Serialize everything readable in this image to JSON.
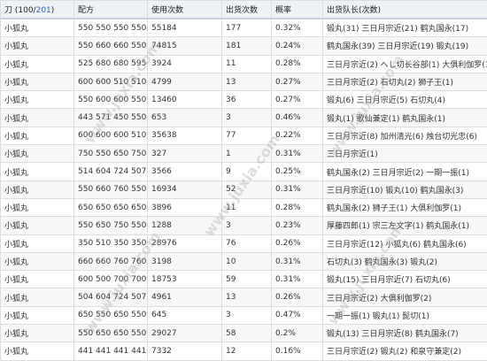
{
  "header": {
    "col1_prefix": "刀 (100/",
    "col1_count": "201",
    "col1_suffix": ")",
    "recipe": "配方",
    "uses": "使用次数",
    "drops": "出货次数",
    "rate": "概率",
    "captain": "出货队长(次数)"
  },
  "rows": [
    {
      "name": "小狐丸",
      "recipe": "550 550 550 550",
      "uses": "55184",
      "drops": "177",
      "rate": "0.32%",
      "captain": "锻丸(31) 三日月宗近(21) 鹤丸国永(17)"
    },
    {
      "name": "小狐丸",
      "recipe": "550 660 660 550",
      "uses": "74815",
      "drops": "181",
      "rate": "0.24%",
      "captain": "鹤丸国永(39) 三日月宗近(19) 锻丸(19)"
    },
    {
      "name": "小狐丸",
      "recipe": "525 680 680 595",
      "uses": "3924",
      "drops": "11",
      "rate": "0.28%",
      "captain": "三日月宗近(2) へし切长谷部(1) 大俱利伽罗(1)"
    },
    {
      "name": "小狐丸",
      "recipe": "600 600 510 510",
      "uses": "4799",
      "drops": "13",
      "rate": "0.27%",
      "captain": "三日月宗近(2) 石切丸(2) 狮子王(1)"
    },
    {
      "name": "小狐丸",
      "recipe": "550 600 600 550",
      "uses": "13460",
      "drops": "36",
      "rate": "0.27%",
      "captain": "锻丸(6) 三日月宗近(5) 石切丸(4)"
    },
    {
      "name": "小狐丸",
      "recipe": "443 571 450 550",
      "uses": "653",
      "drops": "3",
      "rate": "0.46%",
      "captain": "锻丸(1) 歌仙兼定(1) 鹤丸国永(1)"
    },
    {
      "name": "小狐丸",
      "recipe": "600 600 600 510",
      "uses": "35638",
      "drops": "77",
      "rate": "0.22%",
      "captain": "三日月宗近(8) 加州清光(6) 烛台切光忠(6)"
    },
    {
      "name": "小狐丸",
      "recipe": "750 550 650 750",
      "uses": "327",
      "drops": "1",
      "rate": "0.31%",
      "captain": "三日月宗近(1)"
    },
    {
      "name": "小狐丸",
      "recipe": "514 604 724 507",
      "uses": "3566",
      "drops": "9",
      "rate": "0.25%",
      "captain": "鹤丸国永(2) 三日月宗近(2) 一期一振(1)"
    },
    {
      "name": "小狐丸",
      "recipe": "550 660 760 550",
      "uses": "16934",
      "drops": "52",
      "rate": "0.31%",
      "captain": "三日月宗近(10) 锻丸(10) 鹤丸国永(3)"
    },
    {
      "name": "小狐丸",
      "recipe": "650 650 650 650",
      "uses": "3896",
      "drops": "11",
      "rate": "0.28%",
      "captain": "鹤丸国永(2) 狮子王(1) 大俱利伽罗(1)"
    },
    {
      "name": "小狐丸",
      "recipe": "550 650 750 550",
      "uses": "1288",
      "drops": "3",
      "rate": "0.23%",
      "captain": "厚藤四郎(1) 宗三左文字(1) 鹤丸国永(1)"
    },
    {
      "name": "小狐丸",
      "recipe": "350 510 350 350",
      "uses": "28976",
      "drops": "76",
      "rate": "0.26%",
      "captain": "三日月宗近(12) 小狐丸(6) 鹤丸国永(6)"
    },
    {
      "name": "小狐丸",
      "recipe": "660 660 760 760",
      "uses": "3198",
      "drops": "10",
      "rate": "0.31%",
      "captain": "石切丸(3) 鹤丸国永(3) 锻丸(2)"
    },
    {
      "name": "小狐丸",
      "recipe": "600 500 700 700",
      "uses": "18753",
      "drops": "59",
      "rate": "0.31%",
      "captain": "锻丸(15) 三日月宗近(7) 石切丸(6)"
    },
    {
      "name": "小狐丸",
      "recipe": "504 604 724 507",
      "uses": "4961",
      "drops": "13",
      "rate": "0.26%",
      "captain": "三日月宗近(2) 大俱利伽罗(2)"
    },
    {
      "name": "小狐丸",
      "recipe": "650 550 650 550",
      "uses": "645",
      "drops": "3",
      "rate": "0.47%",
      "captain": "一期一振(1) 锻丸(1) 髭切(1)"
    },
    {
      "name": "小狐丸",
      "recipe": "550 650 650 550",
      "uses": "29027",
      "drops": "58",
      "rate": "0.2%",
      "captain": "锻丸(13) 三日月宗近(8) 鹤丸国永(7)"
    },
    {
      "name": "小狐丸",
      "recipe": "441 441 441 441",
      "uses": "7332",
      "drops": "12",
      "rate": "0.16%",
      "captain": "三日月宗近(2) 锻丸(2) 和泉守兼定(2)"
    }
  ],
  "watermark": "www.juxia.com"
}
